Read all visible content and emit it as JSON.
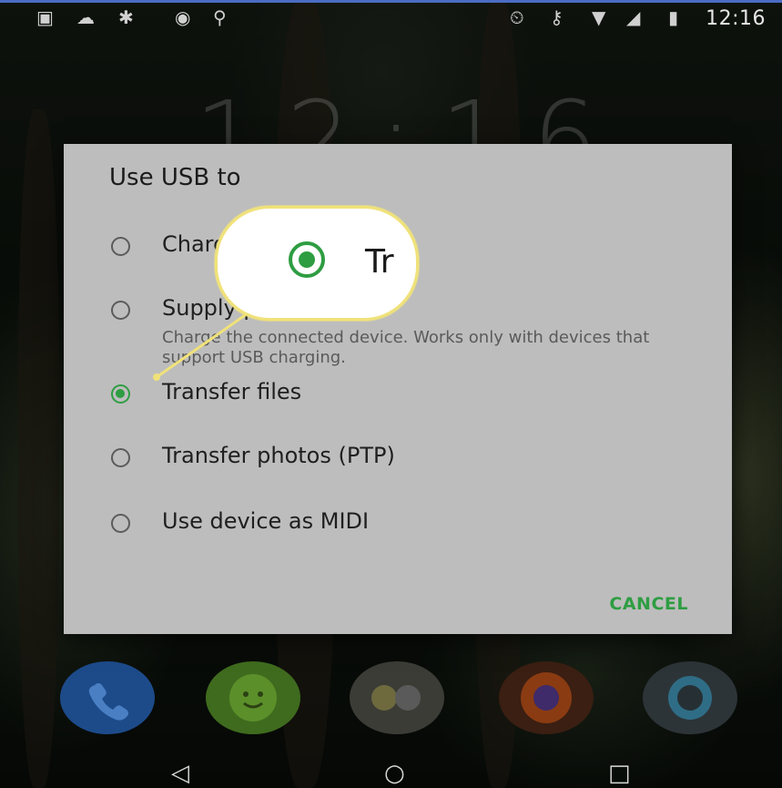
{
  "status_bar": {
    "left_icons": [
      "image-icon",
      "weather-icon",
      "leaf-icon",
      "target-icon",
      "search-icon"
    ],
    "right_icons": [
      "alarm-icon",
      "key-icon",
      "wifi-icon",
      "signal-icon",
      "battery-icon"
    ],
    "time": "12:16"
  },
  "lockscreen": {
    "clock": "12:16"
  },
  "dialog": {
    "title": "Use USB to",
    "options": [
      {
        "label": "Charge this device",
        "checked": false
      },
      {
        "label": "Supply power",
        "description": "Charge the connected device. Works only with devices that support USB charging.",
        "checked": false
      },
      {
        "label": "Transfer files",
        "checked": true
      },
      {
        "label": "Transfer photos (PTP)",
        "checked": false
      },
      {
        "label": "Use device as MIDI",
        "checked": false
      }
    ],
    "cancel_label": "CANCEL"
  },
  "callout": {
    "text": "Tr"
  },
  "dock": [
    "phone-icon",
    "messages-icon",
    "app-folder-icon",
    "firefox-icon",
    "camera-icon"
  ],
  "navbar": {
    "back": "◁",
    "home": "○",
    "recents": "□"
  },
  "colors": {
    "accent": "#2e9d42",
    "callout_border": "#f0e27a",
    "dialog_bg": "#bdbdbd"
  }
}
